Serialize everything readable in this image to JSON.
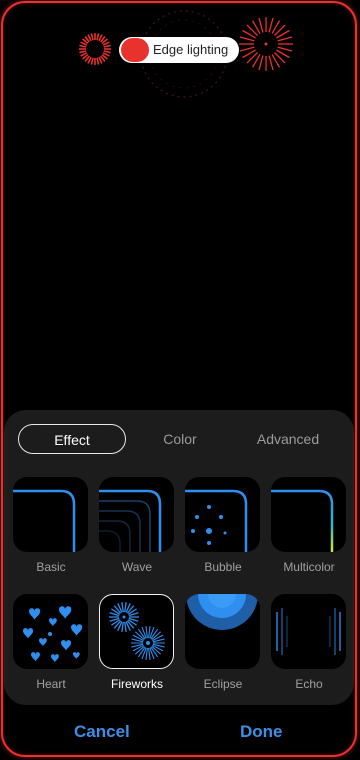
{
  "preview": {
    "toggle_label": "Edge lighting",
    "toggle_on": true,
    "accent_color": "#e8322e"
  },
  "tabs": [
    {
      "label": "Effect",
      "active": true
    },
    {
      "label": "Color",
      "active": false
    },
    {
      "label": "Advanced",
      "active": false
    }
  ],
  "effects": [
    {
      "label": "Basic",
      "icon": "basic-edge-icon",
      "selected": false
    },
    {
      "label": "Wave",
      "icon": "wave-edge-icon",
      "selected": false
    },
    {
      "label": "Bubble",
      "icon": "bubble-edge-icon",
      "selected": false
    },
    {
      "label": "Multicolor",
      "icon": "multicolor-edge-icon",
      "selected": false
    },
    {
      "label": "Heart",
      "icon": "heart-edge-icon",
      "selected": false
    },
    {
      "label": "Fireworks",
      "icon": "fireworks-edge-icon",
      "selected": true
    },
    {
      "label": "Eclipse",
      "icon": "eclipse-edge-icon",
      "selected": false
    },
    {
      "label": "Echo",
      "icon": "echo-edge-icon",
      "selected": false
    }
  ],
  "actions": {
    "cancel_label": "Cancel",
    "done_label": "Done"
  },
  "colors": {
    "effect_blue": "#2f8ff0",
    "action_blue": "#3d8fe6"
  }
}
